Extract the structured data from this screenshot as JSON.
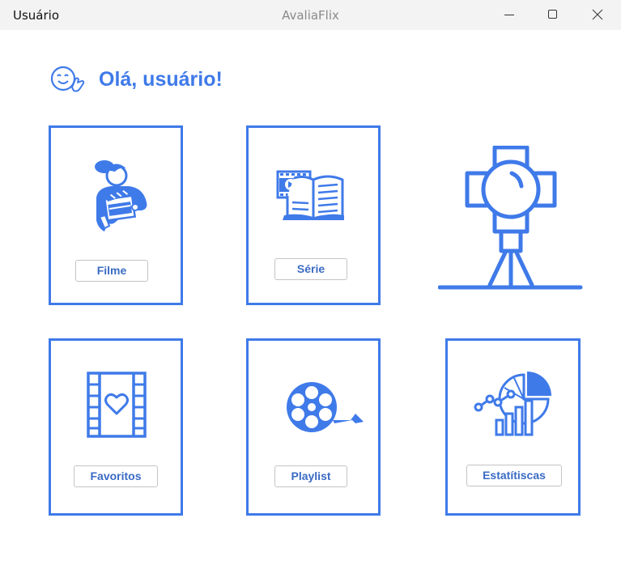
{
  "window": {
    "title_left": "Usuário",
    "title_center": "AvaliaFlix"
  },
  "header": {
    "greeting": "Olá, usuário!",
    "icon": "smiley-face-icon"
  },
  "cards": {
    "filme": {
      "label": "Filme",
      "icon": "woman-clapperboard-icon"
    },
    "serie": {
      "label": "Série",
      "icon": "film-book-icon"
    },
    "favoritos": {
      "label": "Favoritos",
      "icon": "film-heart-icon"
    },
    "playlist": {
      "label": "Playlist",
      "icon": "film-reel-icon"
    },
    "estatisticas": {
      "label": "Estatítiscas",
      "icon": "chart-stats-icon"
    }
  },
  "decor": {
    "icon": "spotlight-icon"
  },
  "colors": {
    "accent": "#3f7ae9",
    "button_text": "#3a6bc4",
    "titlebar": "#f3f3f3"
  }
}
